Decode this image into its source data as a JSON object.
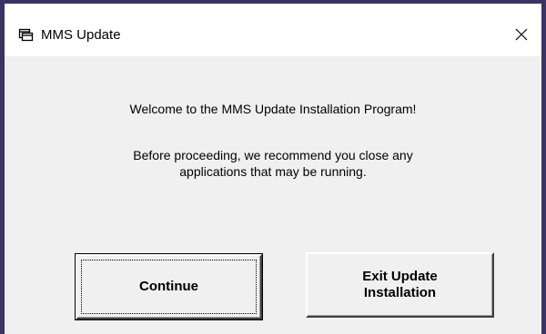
{
  "window": {
    "title": "MMS Update",
    "frame_color": "#3b3363",
    "background": "#f0f0f0"
  },
  "titlebar": {
    "icon": "app-window-icon",
    "close_icon": "close-icon"
  },
  "main": {
    "welcome_text": "Welcome to the MMS Update Installation Program!",
    "advice_line1": "Before proceeding, we recommend you close any",
    "advice_line2": "applications that may be running."
  },
  "buttons": {
    "continue_label": "Continue",
    "exit_label_line1": "Exit Update",
    "exit_label_line2": "Installation"
  }
}
